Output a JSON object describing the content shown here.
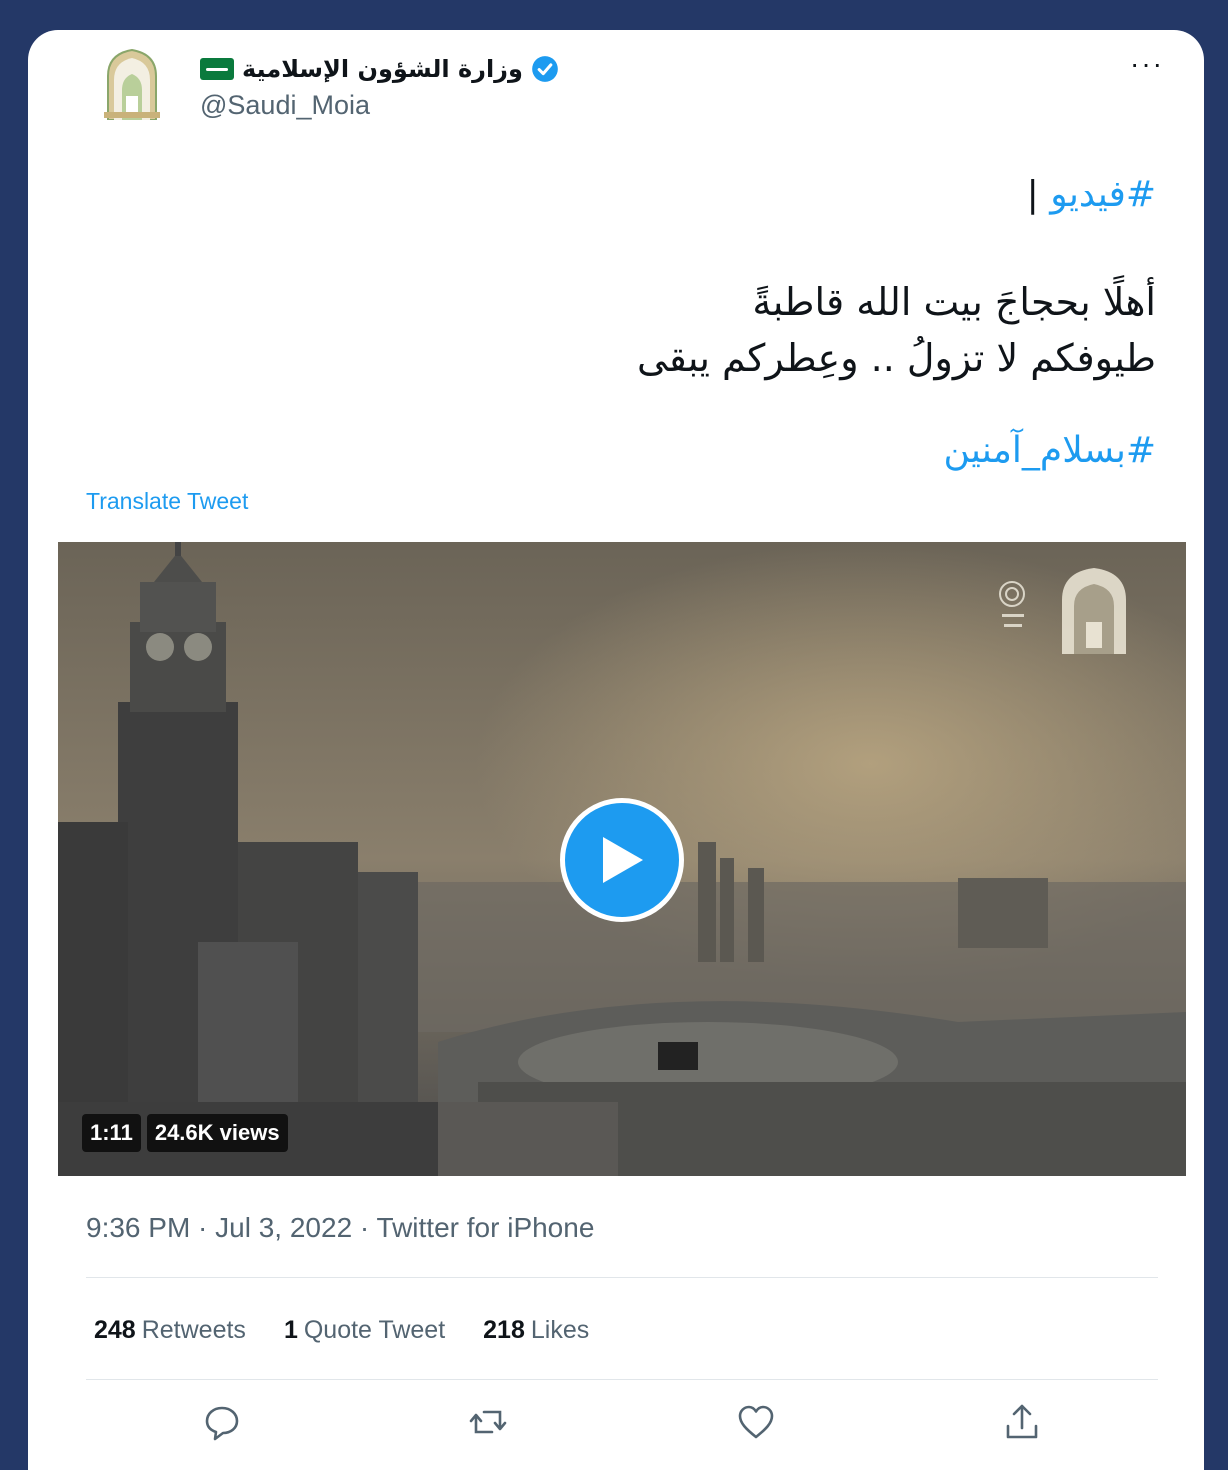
{
  "tweet": {
    "display_name": "وزارة الشؤون الإسلامية",
    "handle": "@Saudi_Moia",
    "more_label": "···",
    "hashtag1": "#فيديو",
    "separator": " |",
    "body_line1": "أهلًا بحجاجَ بيت الله قاطبةً",
    "body_line2": "طيوفكم لا تزولُ .. وعِطركم يبقى",
    "hashtag2": "#بسلام_آمنين",
    "translate_label": "Translate Tweet"
  },
  "video": {
    "duration": "1:11",
    "views": "24.6K views"
  },
  "meta": "9:36 PM · Jul 3, 2022 · Twitter for iPhone",
  "stats": {
    "retweets_count": "248",
    "retweets_label": "Retweets",
    "quotes_count": "1",
    "quotes_label": "Quote Tweet",
    "likes_count": "218",
    "likes_label": "Likes"
  },
  "colors": {
    "background": "#243867",
    "accent": "#1d9bf0",
    "text": "#0f1419",
    "muted": "#536471"
  },
  "icons": [
    "verified-icon",
    "saudi-flag-icon",
    "ministry-logo-icon",
    "play-icon",
    "reply-icon",
    "retweet-icon",
    "like-icon",
    "share-icon"
  ]
}
